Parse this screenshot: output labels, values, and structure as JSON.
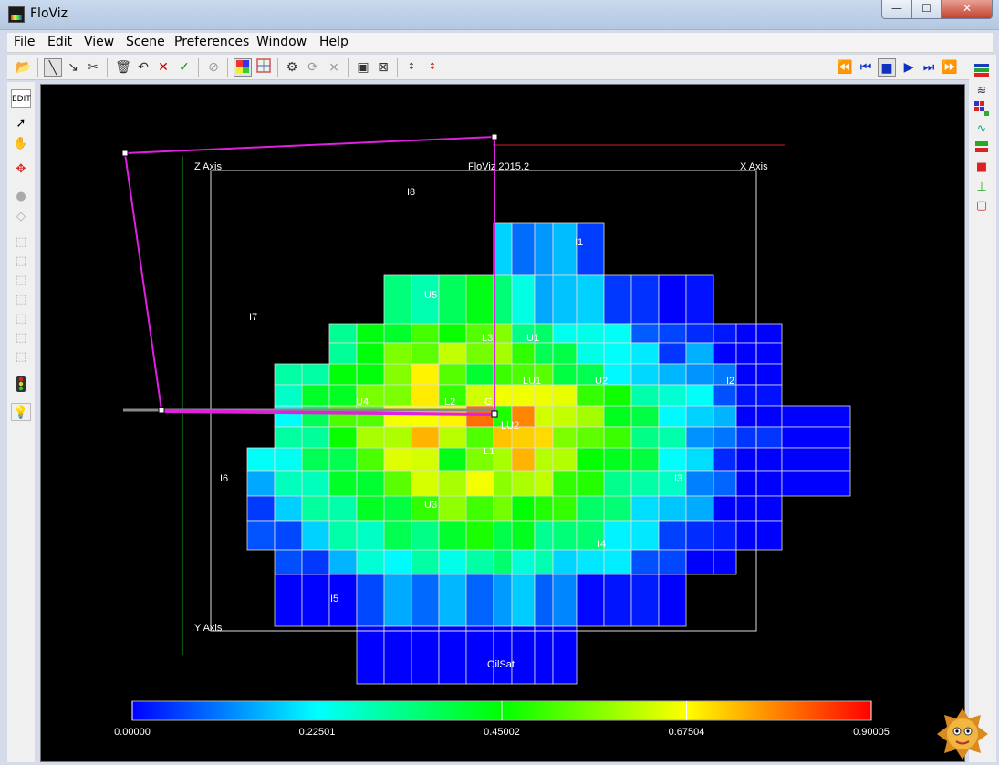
{
  "window": {
    "title": "FloViz",
    "minimize": "—",
    "maximize": "☐",
    "close": "✕"
  },
  "menu": [
    "File",
    "Edit",
    "View",
    "Scene",
    "Preferences",
    "Window",
    "Help"
  ],
  "toolbar": {
    "left_icons": [
      "open-icon",
      "pick-icon",
      "draw-icon",
      "cut-icon",
      "delete-icon",
      "undo-icon",
      "reject-icon",
      "accept-icon",
      "hide-icon",
      "color-cube-icon",
      "wire-cube-icon",
      "settings-icon",
      "rotate-icon",
      "cancel-icon",
      "box-icon",
      "expand-icon",
      "sort-az-icon",
      "sort-za-icon"
    ],
    "playback_icons": [
      "rewind-icon",
      "step-back-icon",
      "stop-icon",
      "play-icon",
      "step-forward-icon",
      "fast-forward-icon"
    ]
  },
  "left_toolbar": {
    "edit_label": "EDIT"
  },
  "viewer": {
    "z_axis": "Z Axis",
    "x_axis": "X Axis",
    "y_axis": "Y Axis",
    "header": "FloViz 2015.2",
    "property": "OilSat",
    "region_labels": [
      {
        "id": "I8",
        "text": "I8"
      },
      {
        "id": "I1",
        "text": "I1"
      },
      {
        "id": "U5",
        "text": "U5"
      },
      {
        "id": "I7",
        "text": "I7"
      },
      {
        "id": "L3",
        "text": "L3"
      },
      {
        "id": "U1",
        "text": "U1"
      },
      {
        "id": "LU1",
        "text": "LU1"
      },
      {
        "id": "U2",
        "text": "U2"
      },
      {
        "id": "I2",
        "text": "I2"
      },
      {
        "id": "U4",
        "text": "U4"
      },
      {
        "id": "L2",
        "text": "L2"
      },
      {
        "id": "G",
        "text": "G"
      },
      {
        "id": "LU2",
        "text": "LU2"
      },
      {
        "id": "L1",
        "text": "L1"
      },
      {
        "id": "I6",
        "text": "I6"
      },
      {
        "id": "I3",
        "text": "I3"
      },
      {
        "id": "U3",
        "text": "U3"
      },
      {
        "id": "I4",
        "text": "I4"
      },
      {
        "id": "I5",
        "text": "I5"
      }
    ],
    "colorbar": {
      "ticks": [
        "0.00000",
        "0.22501",
        "0.45002",
        "0.67504",
        "0.90005"
      ],
      "colors": [
        "#0000ff",
        "#00ffff",
        "#00ff00",
        "#ffff00",
        "#ff0000"
      ]
    }
  }
}
